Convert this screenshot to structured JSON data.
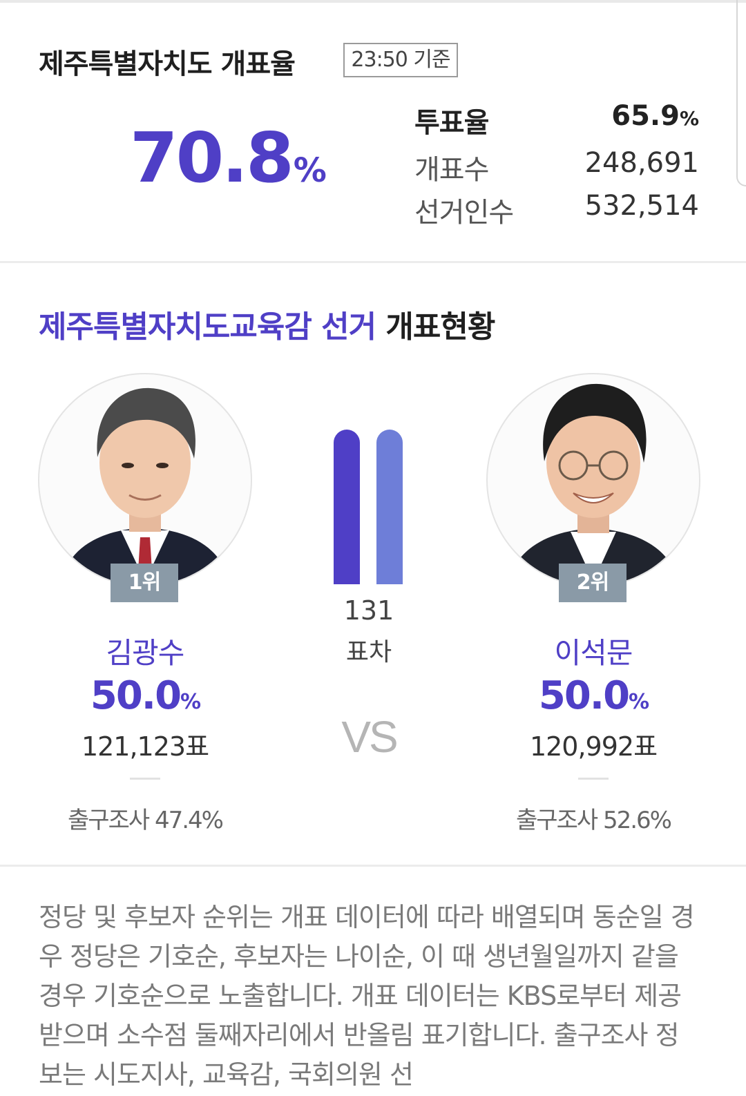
{
  "turnout_panel": {
    "title": "제주특별자치도 개표율",
    "as_of": "23:50 기준",
    "count_rate": "70.8",
    "count_rate_unit": "%",
    "rows": [
      {
        "label": "투표율",
        "value": "65.9",
        "unit": "%"
      },
      {
        "label": "개표수",
        "value": "248,691"
      },
      {
        "label": "선거인수",
        "value": "532,514"
      }
    ]
  },
  "election": {
    "title_highlight": "제주특별자치도교육감 선거",
    "title_rest": "개표현황",
    "margin_value": "131",
    "margin_unit": "표차",
    "vs_label": "VS",
    "vote_share_fraction": {
      "first": 0.5,
      "second": 0.5
    },
    "accent_color": "#4f3fc6",
    "second_bar_color": "#6e7ed8",
    "candidates": [
      {
        "rank": "1위",
        "name": "김광수",
        "pct": "50.0",
        "pct_unit": "%",
        "votes": "121,123표",
        "exit_poll": "출구조사 47.4%"
      },
      {
        "rank": "2위",
        "name": "이석문",
        "pct": "50.0",
        "pct_unit": "%",
        "votes": "120,992표",
        "exit_poll": "출구조사 52.6%"
      }
    ]
  },
  "notice_text": "정당 및 후보자 순위는 개표 데이터에 따라 배열되며 동순일 경우 정당은 기호순, 후보자는 나이순, 이 때 생년월일까지 같을 경우 기호순으로 노출합니다. 개표 데이터는 KBS로부터 제공받으며 소수점 둘째자리에서 반올림 표기합니다. 출구조사 정보는 시도지사, 교육감, 국회의원 선"
}
